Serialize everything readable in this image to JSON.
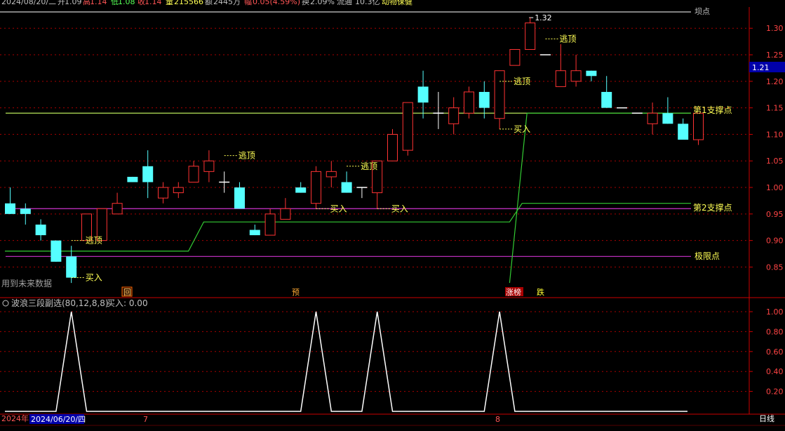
{
  "header": {
    "date": "2024/08/20/二",
    "open_label": "开",
    "open_value": "1.09",
    "high_label": "高",
    "high_value": "1.14",
    "low_label": "低",
    "low_value": "1.08",
    "close_label": "收",
    "close_value": "1.14",
    "volume_label": "量",
    "volume_value": "215566",
    "amount_label": "额",
    "amount_value": "2445万",
    "change_label": "幅",
    "change_value": "0.05(4.59%)",
    "turnover_label": "换",
    "turnover_value": "2.09%",
    "float_label": "流通",
    "float_value": "10.3亿",
    "extra": "动物保健",
    "right_label": "坝点"
  },
  "colors": {
    "up": "#ff3333",
    "down": "#55ffff",
    "background": "#000000",
    "grid": "#aa0000",
    "support": "#ccff66",
    "stepline": "#33cc33",
    "limit": "#cc33cc",
    "price_tag": "#0000aa"
  },
  "main_panel": {
    "price_tag": "1.21",
    "max_label": "1.32",
    "future_data_note": "用到未来数据",
    "line_labels": {
      "support1": "第1支撑点",
      "support2": "第2支撑点",
      "limit": "极限点"
    },
    "markers": [
      {
        "text": "回",
        "kind": "box"
      },
      {
        "text": "预",
        "kind": "plain"
      },
      {
        "text": "涨榜",
        "kind": "red"
      },
      {
        "text": "跌",
        "kind": "green"
      }
    ]
  },
  "sub_panel": {
    "title": "波浪三段副选(80,12,8,8)",
    "buy_label": "买入: 0.00"
  },
  "footer": {
    "date_prefix": "2024年",
    "date_box": "2024/06/20/四",
    "tick_1": "7",
    "tick_2": "8",
    "period": "日线"
  },
  "chart_data": {
    "type": "candlestick",
    "y_ticks": [
      0.85,
      0.9,
      0.95,
      1.0,
      1.05,
      1.1,
      1.15,
      1.2,
      1.25,
      1.3
    ],
    "ylim": [
      0.795,
      1.34
    ],
    "candles": [
      [
        0.97,
        1.0,
        0.95,
        0.95
      ],
      [
        0.96,
        0.97,
        0.93,
        0.95
      ],
      [
        0.93,
        0.94,
        0.9,
        0.91
      ],
      [
        0.9,
        0.9,
        0.86,
        0.86
      ],
      [
        0.87,
        0.89,
        0.82,
        0.83
      ],
      [
        0.9,
        0.95,
        0.9,
        0.95
      ],
      [
        0.9,
        0.96,
        0.9,
        0.96
      ],
      [
        0.95,
        0.99,
        0.95,
        0.97
      ],
      [
        1.02,
        1.02,
        1.01,
        1.01
      ],
      [
        1.04,
        1.07,
        0.98,
        1.01
      ],
      [
        0.98,
        1.01,
        0.97,
        1.0
      ],
      [
        0.99,
        1.01,
        0.98,
        1.0
      ],
      [
        1.01,
        1.05,
        1.01,
        1.04
      ],
      [
        1.03,
        1.07,
        1.01,
        1.05
      ],
      [
        1.01,
        1.03,
        0.99,
        1.01
      ],
      [
        1.0,
        1.01,
        0.96,
        0.96
      ],
      [
        0.92,
        0.93,
        0.91,
        0.91
      ],
      [
        0.91,
        0.96,
        0.91,
        0.95
      ],
      [
        0.94,
        0.98,
        0.94,
        0.96
      ],
      [
        1.0,
        1.01,
        0.99,
        0.99
      ],
      [
        0.97,
        1.04,
        0.96,
        1.03
      ],
      [
        1.02,
        1.05,
        1.0,
        1.03
      ],
      [
        1.01,
        1.03,
        0.99,
        0.99
      ],
      [
        1.0,
        1.0,
        0.98,
        1.0
      ],
      [
        0.99,
        1.05,
        0.96,
        1.05
      ],
      [
        1.05,
        1.11,
        1.05,
        1.1
      ],
      [
        1.07,
        1.16,
        1.06,
        1.16
      ],
      [
        1.19,
        1.22,
        1.13,
        1.16
      ],
      [
        1.14,
        1.18,
        1.11,
        1.14
      ],
      [
        1.12,
        1.17,
        1.1,
        1.15
      ],
      [
        1.14,
        1.19,
        1.13,
        1.18
      ],
      [
        1.18,
        1.2,
        1.13,
        1.15
      ],
      [
        1.13,
        1.22,
        1.11,
        1.22
      ],
      [
        1.23,
        1.26,
        1.23,
        1.26
      ],
      [
        1.26,
        1.32,
        1.26,
        1.31
      ],
      [
        1.25,
        1.25,
        1.25,
        1.25
      ],
      [
        1.19,
        1.27,
        1.19,
        1.22
      ],
      [
        1.2,
        1.25,
        1.19,
        1.22
      ],
      [
        1.22,
        1.22,
        1.2,
        1.21
      ],
      [
        1.18,
        1.21,
        1.15,
        1.15
      ],
      [
        1.15,
        1.15,
        1.15,
        1.15
      ],
      [
        1.14,
        1.14,
        1.14,
        1.14
      ],
      [
        1.12,
        1.16,
        1.1,
        1.14
      ],
      [
        1.14,
        1.17,
        1.12,
        1.12
      ],
      [
        1.12,
        1.13,
        1.09,
        1.09
      ],
      [
        1.09,
        1.14,
        1.08,
        1.14
      ]
    ],
    "support_1": 1.14,
    "support_2": 0.96,
    "limit_point": 0.87,
    "step_line": [
      {
        "from": 0,
        "to": 12,
        "value": 0.88
      },
      {
        "from": 13,
        "to": 33,
        "value": 0.935
      },
      {
        "from": 34,
        "to": 45,
        "value": 0.97
      }
    ],
    "step_line_mid": 1.14,
    "top_labels": [
      {
        "index": 4,
        "price": 0.9,
        "text": "逃顶"
      },
      {
        "index": 14,
        "price": 1.06,
        "text": "逃顶"
      },
      {
        "index": 22,
        "price": 1.04,
        "text": "逃顶"
      },
      {
        "index": 32,
        "price": 1.2,
        "text": "逃顶"
      },
      {
        "index": 35,
        "price": 1.28,
        "text": "逃顶"
      }
    ],
    "buy_labels": [
      {
        "index": 4,
        "price": 0.83,
        "text": "买入"
      },
      {
        "index": 20,
        "price": 0.96,
        "text": "买入"
      },
      {
        "index": 24,
        "price": 0.96,
        "text": "买入"
      },
      {
        "index": 32,
        "price": 1.11,
        "text": "买入"
      }
    ],
    "sub_indicator": {
      "name": "买入",
      "ylim": [
        0,
        1
      ],
      "y_ticks": [
        0.2,
        0.4,
        0.6,
        0.8,
        1.0
      ],
      "pulses": [
        4,
        20,
        24,
        32
      ]
    }
  }
}
